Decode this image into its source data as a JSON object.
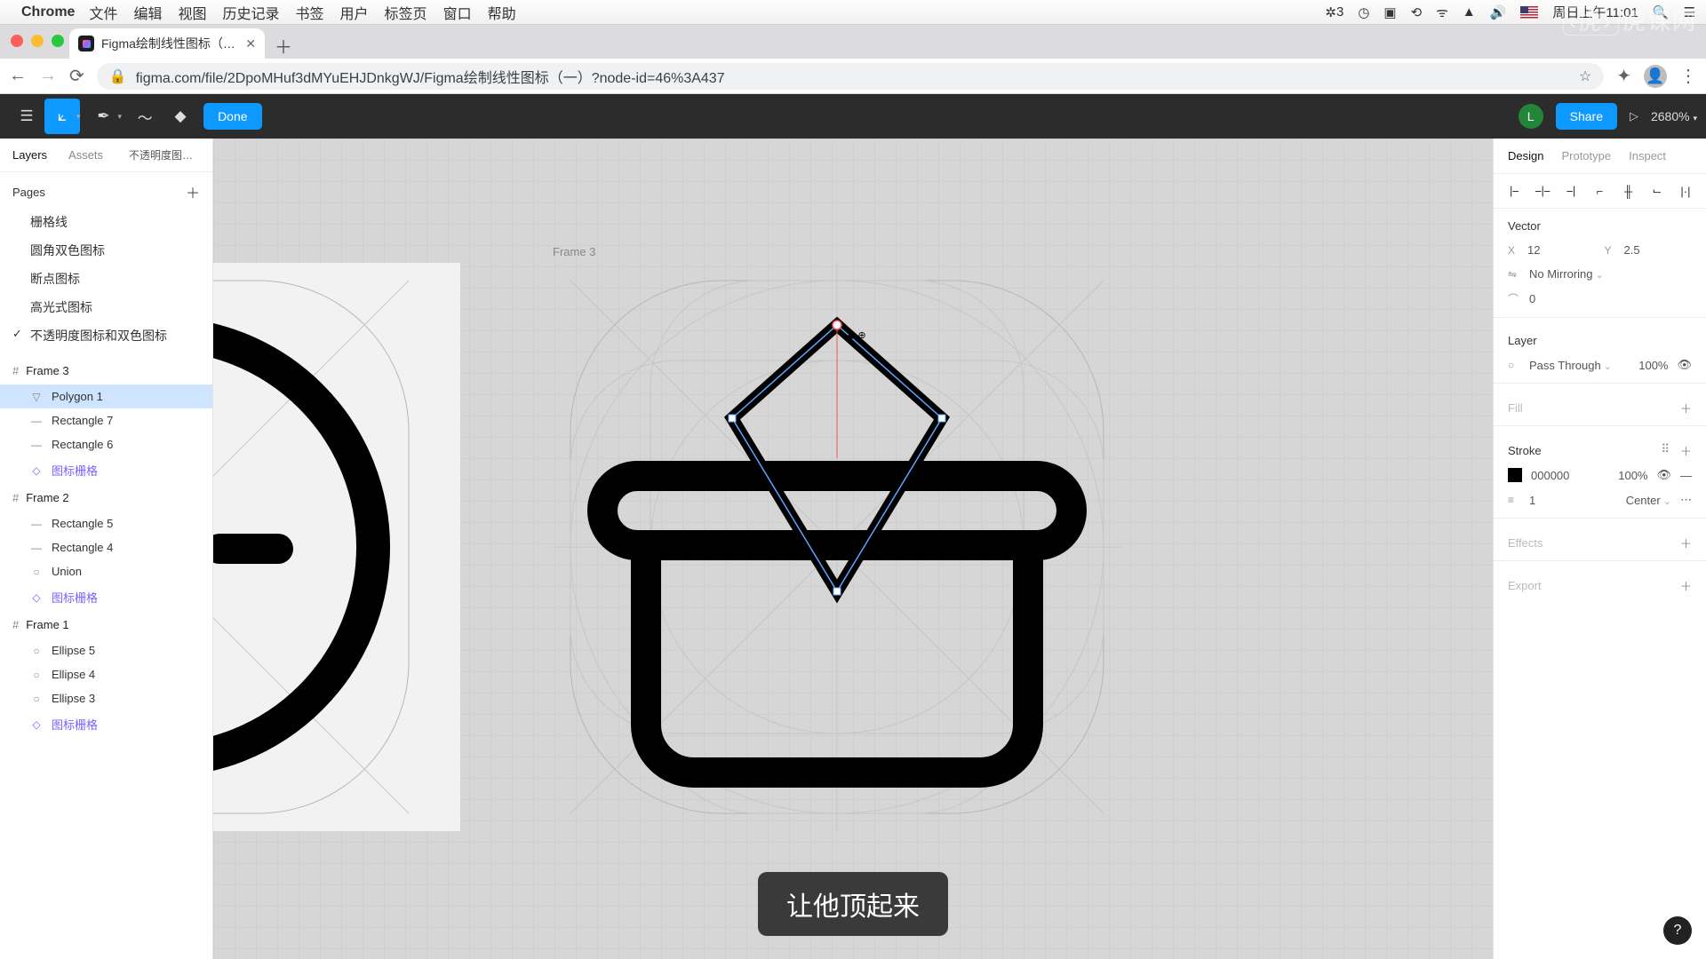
{
  "mac": {
    "app": "Chrome",
    "menus": [
      "文件",
      "编辑",
      "视图",
      "历史记录",
      "书签",
      "用户",
      "标签页",
      "窗口",
      "帮助"
    ],
    "badge": "3",
    "clock": "周日上午11:01"
  },
  "browser": {
    "tab_title": "Figma绘制线性图标（一）– Fi…",
    "url": "figma.com/file/2DpoMHuf3dMYuEHJDnkgWJ/Figma绘制线性图标（一）?node-id=46%3A437"
  },
  "toolbar": {
    "done": "Done",
    "share": "Share",
    "zoom": "2680%",
    "user_initial": "L"
  },
  "left": {
    "tab_layers": "Layers",
    "tab_assets": "Assets",
    "breadcrumb": "不透明度图标…",
    "pages_label": "Pages",
    "pages": [
      {
        "label": "栅格线"
      },
      {
        "label": "圆角双色图标"
      },
      {
        "label": "断点图标"
      },
      {
        "label": "高光式图标"
      },
      {
        "label": "不透明度图标和双色图标",
        "current": true
      }
    ],
    "frames": [
      {
        "title": "Frame 3",
        "layers": [
          {
            "icon": "▽",
            "label": "Polygon 1",
            "sel": true
          },
          {
            "icon": "—",
            "label": "Rectangle 7"
          },
          {
            "icon": "—",
            "label": "Rectangle 6"
          },
          {
            "icon": "◇",
            "label": "图标栅格",
            "comp": true
          }
        ]
      },
      {
        "title": "Frame 2",
        "layers": [
          {
            "icon": "—",
            "label": "Rectangle 5"
          },
          {
            "icon": "—",
            "label": "Rectangle 4"
          },
          {
            "icon": "○",
            "label": "Union"
          },
          {
            "icon": "◇",
            "label": "图标栅格",
            "comp": true
          }
        ]
      },
      {
        "title": "Frame 1",
        "layers": [
          {
            "icon": "○",
            "label": "Ellipse 5"
          },
          {
            "icon": "○",
            "label": "Ellipse 4"
          },
          {
            "icon": "○",
            "label": "Ellipse 3"
          },
          {
            "icon": "◇",
            "label": "图标栅格",
            "comp": true
          }
        ]
      }
    ]
  },
  "canvas": {
    "frame_label": "Frame 3",
    "subtitle": "让他顶起来"
  },
  "right": {
    "tab_design": "Design",
    "tab_prototype": "Prototype",
    "tab_inspect": "Inspect",
    "vector_label": "Vector",
    "x_label": "X",
    "x_val": "12",
    "y_label": "Y",
    "y_val": "2.5",
    "mirroring": "No Mirroring",
    "corner": "0",
    "layer_label": "Layer",
    "blend": "Pass Through",
    "opacity": "100%",
    "fill_label": "Fill",
    "stroke_label": "Stroke",
    "stroke_color": "000000",
    "stroke_opacity": "100%",
    "stroke_weight": "1",
    "stroke_align": "Center",
    "effects_label": "Effects",
    "export_label": "Export"
  },
  "help": "?",
  "watermark": "虎课网"
}
